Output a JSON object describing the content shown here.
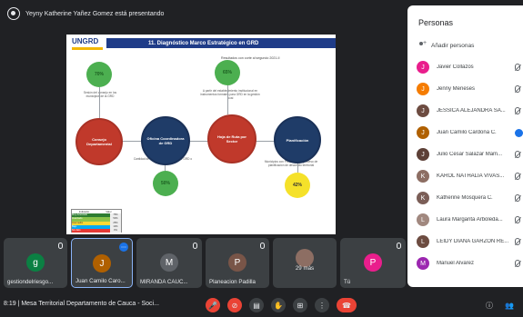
{
  "banner": {
    "text": "Yeyny Katherine Yañez Gomez está presentando"
  },
  "slide": {
    "logo": "UNGRD",
    "title": "11. Diagnóstico Marco Estratégico en GRD",
    "subheading": "Resultados con corte al segundo 2021-II",
    "nodes": [
      {
        "num": "1",
        "label": "Consejo Departamental",
        "color": "#c0392b"
      },
      {
        "num": "2",
        "label": "Oficina Coordinadora de GRD",
        "color": "#1f3c68"
      },
      {
        "num": "3",
        "label": "Hoja de Ruta por Sector",
        "color": "#c0392b"
      },
      {
        "num": "4",
        "label": "Planificación",
        "color": "#1f3c68"
      }
    ],
    "percents": {
      "top_left": "70%",
      "top_mid": "65%",
      "bottom_mid": "50%",
      "bottom_right": "42%"
    },
    "notes": {
      "n1": "Sesión del consejo en los municipios de la GRD",
      "n2": "A partir del establecimiento institucional en instrumentos formales para GRD en la gestión local",
      "n3": "Cantidad de Municipios con oficina de GRD o coordinador",
      "n4": "Municipios con PMGRD en el proceso de planificación de desarrollo territorial"
    },
    "table": {
      "headers": [
        "Indicador",
        "Valor"
      ],
      "rows": [
        {
          "color": "#2e7d32",
          "label": "Muy Avanzado",
          "value": "75%"
        },
        {
          "color": "#8bc34a",
          "label": "Avanzado",
          "value": "50%"
        },
        {
          "color": "#fdd835",
          "label": "Intermedio",
          "value": "25%"
        },
        {
          "color": "#03a9f4",
          "label": "Bajo",
          "value": "10%"
        },
        {
          "color": "#e53935",
          "label": "Sin dato",
          "value": "0%"
        }
      ]
    }
  },
  "tiles": [
    {
      "name": "gestiondelriesgo...",
      "initial": "g",
      "color": "#0b8043"
    },
    {
      "name": "Juan Camilo Caro...",
      "initial": "J",
      "color": "#b06000"
    },
    {
      "name": "MIRANDA CAUC...",
      "initial": "M",
      "color": "#5f6368"
    },
    {
      "name": "Planeacion Padilla",
      "initial": "P",
      "color": "#795548"
    },
    {
      "name": "29 más",
      "initial": "",
      "color": "#3c4043"
    },
    {
      "name": "Tú",
      "initial": "P",
      "color": "#e91e8c"
    }
  ],
  "bottom": {
    "time_title": "8:19 | Mesa Territorial Departamento de Cauca - Soci..."
  },
  "panel": {
    "title": "Personas",
    "add_label": "Añadir personas",
    "people": [
      {
        "name": "Javier Collazos",
        "initial": "J",
        "color": "#e91e8c"
      },
      {
        "name": "Jenny Meneses",
        "initial": "J",
        "color": "#f57c00"
      },
      {
        "name": "JESSICA ALEJANDRA SA...",
        "initial": "J",
        "color": "#6d4c41"
      },
      {
        "name": "Juan Camilo Cardona C.",
        "initial": "J",
        "color": "#b06000"
      },
      {
        "name": "Julio Cesar Salazar Mam...",
        "initial": "J",
        "color": "#5d4037"
      },
      {
        "name": "KAROL NATHALIA VIVAS...",
        "initial": "K",
        "color": "#8d6e63"
      },
      {
        "name": "Katherine Mosquera C.",
        "initial": "K",
        "color": "#7b5e57"
      },
      {
        "name": "Laura Margarita Arboleda...",
        "initial": "L",
        "color": "#a1887f"
      },
      {
        "name": "LEIDY DIANA GARZON RE...",
        "initial": "L",
        "color": "#6d4c41"
      },
      {
        "name": "Manuel Alvarez",
        "initial": "M",
        "color": "#9c27b0"
      }
    ]
  }
}
